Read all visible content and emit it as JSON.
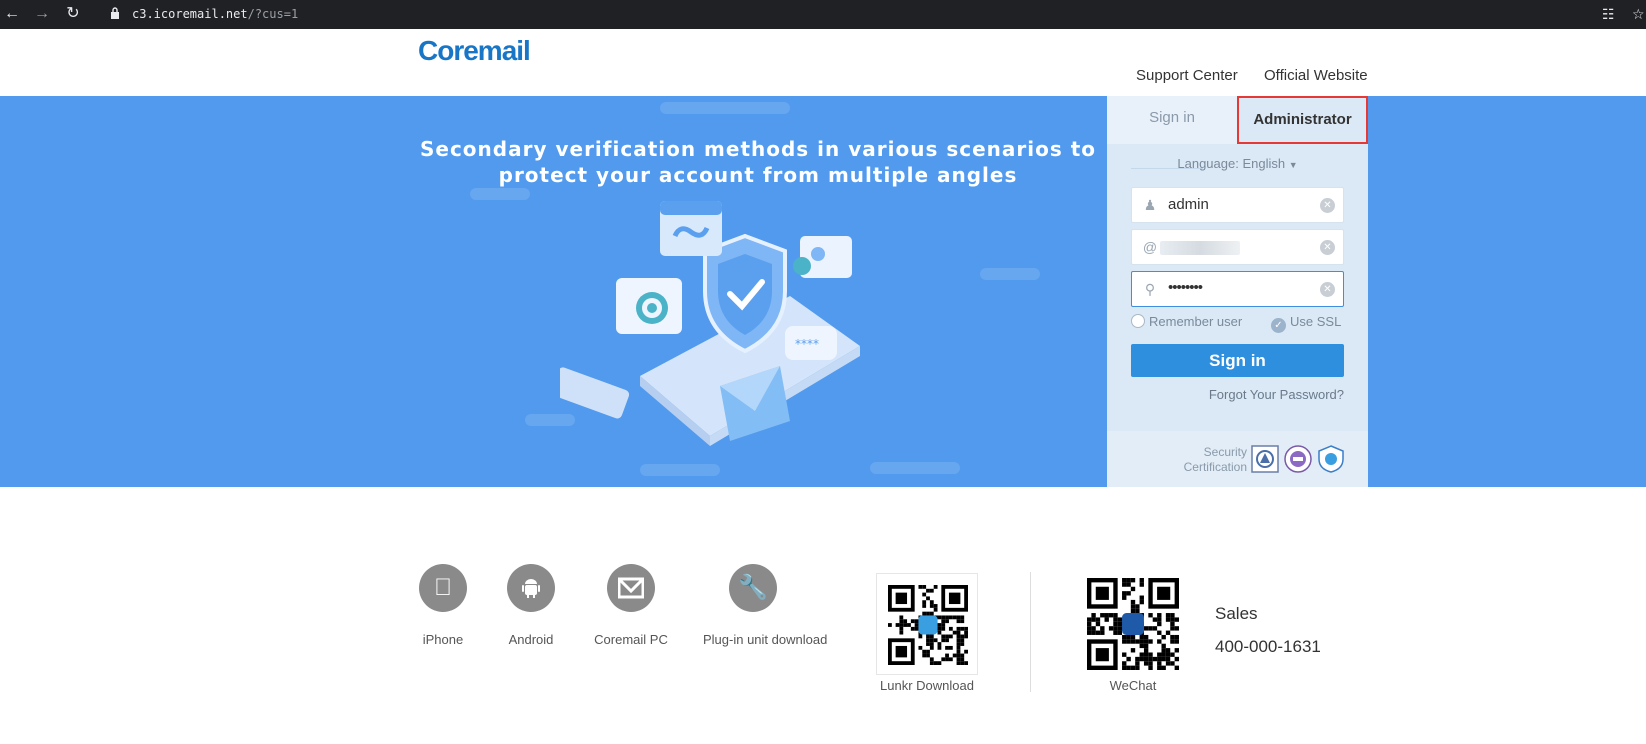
{
  "browser": {
    "url_host": "c3.icoremail.net",
    "url_path": "/?cus=1",
    "back_icon": "arrow-left-icon",
    "forward_icon": "arrow-right-icon",
    "reload_icon": "reload-icon"
  },
  "header": {
    "logo": "Coremail",
    "links": [
      "Support Center",
      "Official Website"
    ]
  },
  "banner": {
    "title_line1": "Secondary verification methods in various scenarios to",
    "title_line2": "protect your account from multiple angles",
    "background": "#519aee"
  },
  "login": {
    "tabs": [
      {
        "label": "Sign in",
        "active": false
      },
      {
        "label": "Administrator",
        "active": true
      }
    ],
    "language": "Language: English",
    "username": {
      "value": "admin",
      "icon": "user-icon"
    },
    "domain": {
      "prefix": "@",
      "value": "",
      "icon": "at-icon"
    },
    "password": {
      "value": "••••••••",
      "icon": "key-icon"
    },
    "remember_user": "Remember user",
    "use_ssl": "Use SSL",
    "sign_in_button": "Sign in",
    "forgot_password": "Forgot Your Password?",
    "security_label_1": "Security",
    "security_label_2": "Certification",
    "accent_color": "#2e8fde",
    "highlight_color": "#e53935"
  },
  "footer": {
    "apps": [
      {
        "label": "iPhone",
        "icon": "apple-icon"
      },
      {
        "label": "Android",
        "icon": "android-icon"
      },
      {
        "label": "Coremail PC",
        "icon": "mail-icon"
      },
      {
        "label": "Plug-in unit download",
        "icon": "wrench-icon"
      }
    ],
    "lunkr_label": "Lunkr Download",
    "wechat_label": "WeChat",
    "sales_label": "Sales",
    "sales_phone": "400-000-1631"
  }
}
